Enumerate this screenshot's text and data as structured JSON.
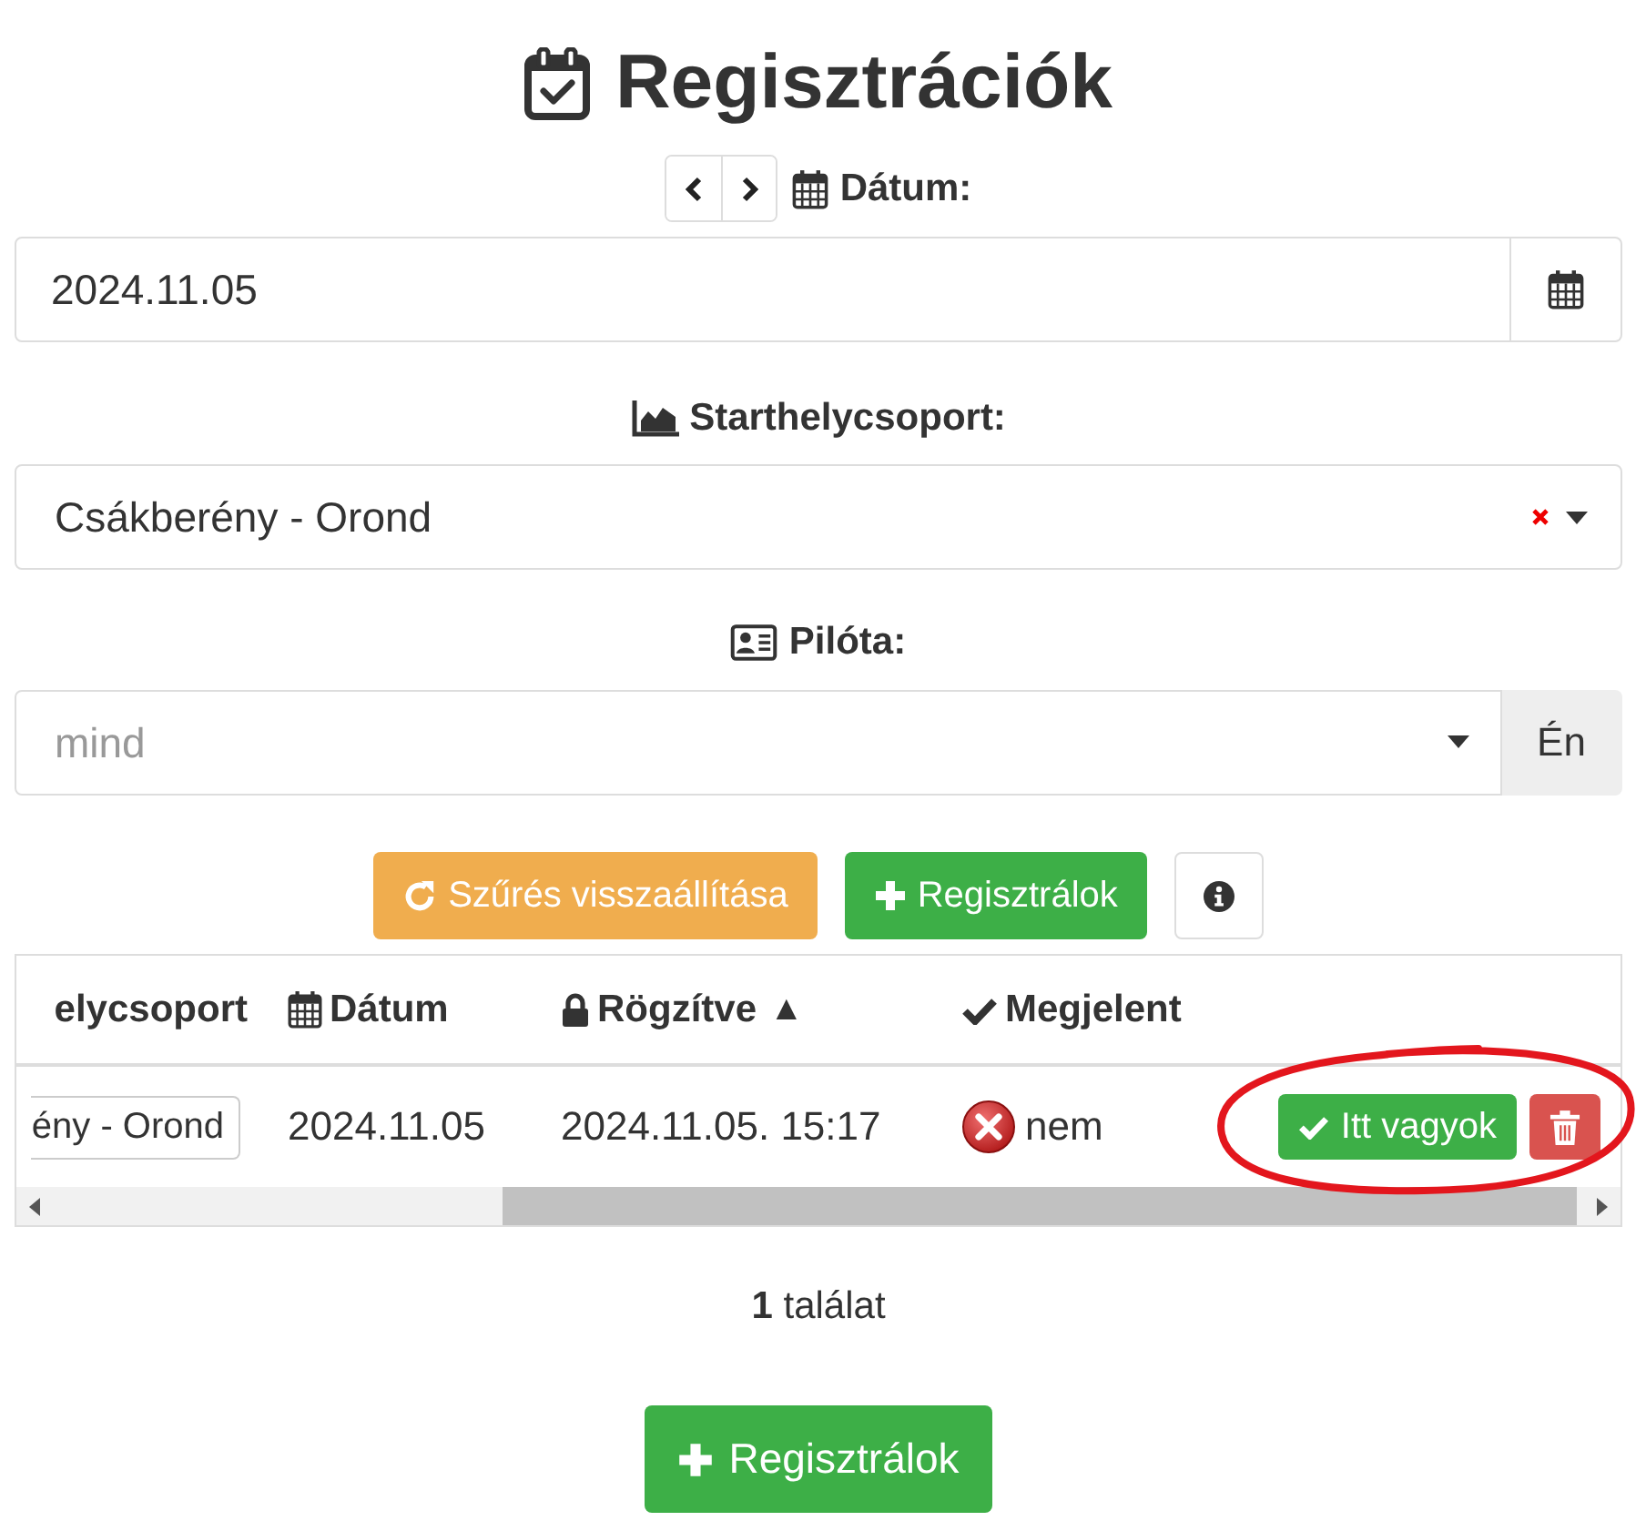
{
  "title": {
    "text": "Regisztrációk"
  },
  "date_filter": {
    "label": "Dátum:",
    "value": "2024.11.05"
  },
  "site_filter": {
    "label": "Starthelycsoport:",
    "value": "Csákberény - Orond",
    "clearable": true
  },
  "pilot_filter": {
    "label": "Pilóta:",
    "placeholder": "mind",
    "addon": "Én"
  },
  "actions": [
    {
      "kind": "reset",
      "label": "Szűrés visszaállítása"
    },
    {
      "kind": "add",
      "label": "Regisztrálok"
    },
    {
      "kind": "info"
    }
  ],
  "table": {
    "columns": [
      {
        "kind": "text",
        "label": "elycsoport"
      },
      {
        "kind": "date",
        "label": "Dátum"
      },
      {
        "kind": "timestamp",
        "label": "Rögzítve",
        "sort": "▲"
      },
      {
        "kind": "status",
        "label": "Megjelent"
      }
    ],
    "rows": [
      {
        "site": "ény - Orond",
        "date": "2024.11.05",
        "recorded": "2024.11.05. 15:17",
        "appeared": {
          "value": false,
          "label": "nem"
        },
        "actions": [
          {
            "kind": "check_in",
            "label": "Itt vagyok"
          },
          {
            "kind": "delete"
          }
        ],
        "actions_circled": true
      }
    ]
  },
  "result_count": "**1** találat",
  "footer_button": {
    "label": "Regisztrálok"
  }
}
